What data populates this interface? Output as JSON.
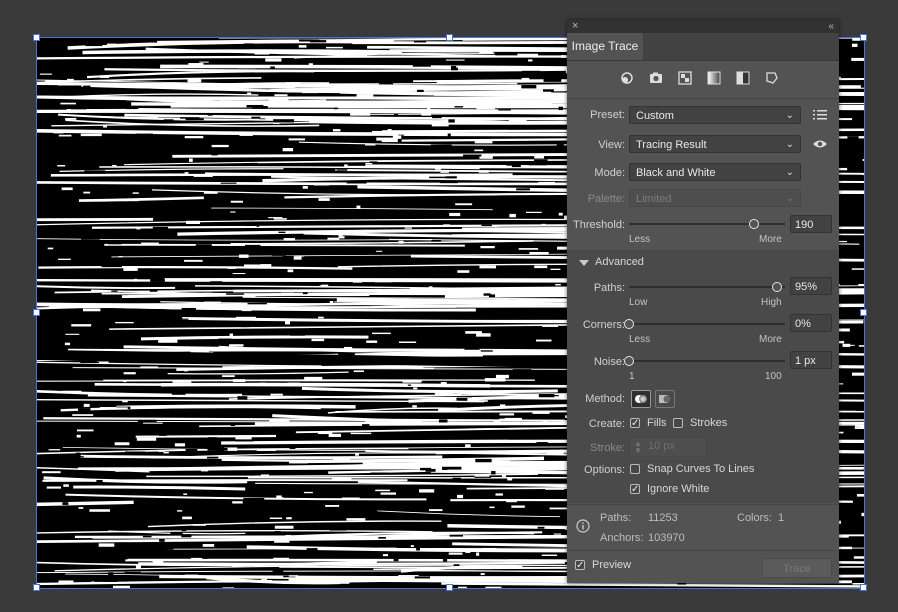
{
  "panel": {
    "close": "×",
    "collapse": "‹‹",
    "tab": "Image Trace",
    "preset_icons": [
      "auto-color-icon",
      "high-color-icon",
      "low-color-icon",
      "grayscale-icon",
      "black-white-icon",
      "outline-icon"
    ],
    "preset": {
      "label": "Preset:",
      "value": "Custom"
    },
    "view": {
      "label": "View:",
      "value": "Tracing Result"
    },
    "mode": {
      "label": "Mode:",
      "value": "Black and White"
    },
    "palette": {
      "label": "Palette:",
      "value": "Limited"
    },
    "threshold": {
      "label": "Threshold:",
      "value": "190",
      "min_label": "Less",
      "max_label": "More",
      "level": 0.8
    },
    "advanced": {
      "label": "Advanced"
    },
    "paths": {
      "label": "Paths:",
      "value": "95%",
      "min_label": "Low",
      "max_label": "High",
      "level": 0.95
    },
    "corners": {
      "label": "Corners:",
      "value": "0%",
      "min_label": "Less",
      "max_label": "More",
      "level": 0.0
    },
    "noise": {
      "label": "Noise:",
      "value": "1 px",
      "min_label": "1",
      "max_label": "100",
      "level": 0.0
    },
    "method": {
      "label": "Method:"
    },
    "create": {
      "label": "Create:",
      "fills_label": "Fills",
      "fills_checked": true,
      "strokes_label": "Strokes",
      "strokes_checked": false
    },
    "stroke": {
      "label": "Stroke:",
      "value": "10 px"
    },
    "options": {
      "label": "Options:",
      "snap_label": "Snap Curves To Lines",
      "snap_checked": false,
      "ignore_white_label": "Ignore White",
      "ignore_white_checked": true
    },
    "info": {
      "paths_label": "Paths:",
      "paths_value": "11253",
      "colors_label": "Colors:",
      "colors_value": "1",
      "anchors_label": "Anchors:",
      "anchors_value": "103970"
    },
    "preview": {
      "label": "Preview",
      "checked": true
    },
    "trace_button": "Trace"
  },
  "colors": {
    "panel_bg": "#535353",
    "selection": "#4c6fe0",
    "canvas_bg": "#3a3a3a"
  }
}
